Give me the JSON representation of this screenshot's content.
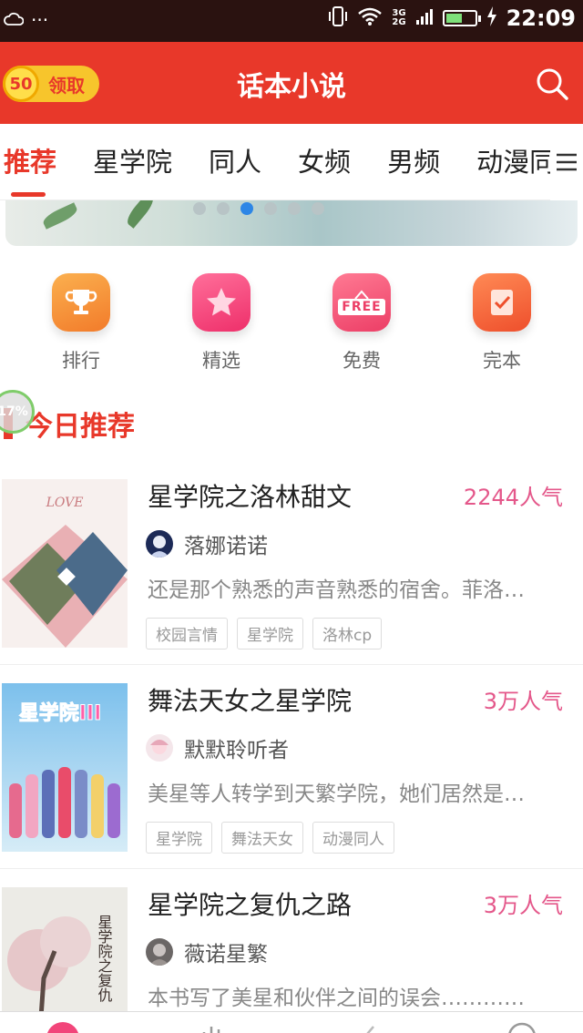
{
  "status_bar": {
    "left_icons": [
      "cloud-icon",
      "more-icon"
    ],
    "network_3g": "3G",
    "network_2g": "2G",
    "battery_level": 0.55,
    "time": "22:09"
  },
  "header": {
    "coin_value": "50",
    "claim_label": "领取",
    "title": "话本小说",
    "search_icon": "search-icon"
  },
  "tabs": [
    {
      "label": "推荐",
      "active": true
    },
    {
      "label": "星学院",
      "active": false
    },
    {
      "label": "同人",
      "active": false
    },
    {
      "label": "女频",
      "active": false
    },
    {
      "label": "男频",
      "active": false
    },
    {
      "label": "动漫同",
      "active": false
    }
  ],
  "banner": {
    "dot_count": 6,
    "active_dot": 2
  },
  "quick_entries": [
    {
      "label": "排行",
      "icon": "trophy-icon",
      "color": "#f7903a"
    },
    {
      "label": "精选",
      "icon": "star-icon",
      "color": "#f2457a"
    },
    {
      "label": "免费",
      "icon": "free-icon",
      "color": "#f0527a",
      "badge": "FREE"
    },
    {
      "label": "完本",
      "icon": "checkbook-icon",
      "color": "#f4663a"
    }
  ],
  "floating_progress": "17%",
  "section": {
    "title": "今日推荐"
  },
  "books": [
    {
      "title": "星学院之洛林甜文",
      "popularity": "2244人气",
      "author": "落娜诺诺",
      "description": "还是那个熟悉的声音熟悉的宿舍。菲洛…",
      "tags": [
        "校园言情",
        "星学院",
        "洛林cp"
      ],
      "cover_text": "LOVE"
    },
    {
      "title": "舞法天女之星学院",
      "popularity": "3万人气",
      "author": "默默聆听者",
      "description": "美星等人转学到天繁学院，她们居然是…",
      "tags": [
        "星学院",
        "舞法天女",
        "动漫同人"
      ],
      "cover_text": "星学院III"
    },
    {
      "title": "星学院之复仇之路",
      "popularity": "3万人气",
      "author": "薇诺星繁",
      "description": "本书写了美星和伙伴之间的误会…………",
      "tags": [],
      "cover_text": "星学院之复仇"
    }
  ],
  "colors": {
    "brand_red": "#e8382a",
    "popularity_pink": "#e4578a",
    "active_dot": "#2d86e6"
  }
}
